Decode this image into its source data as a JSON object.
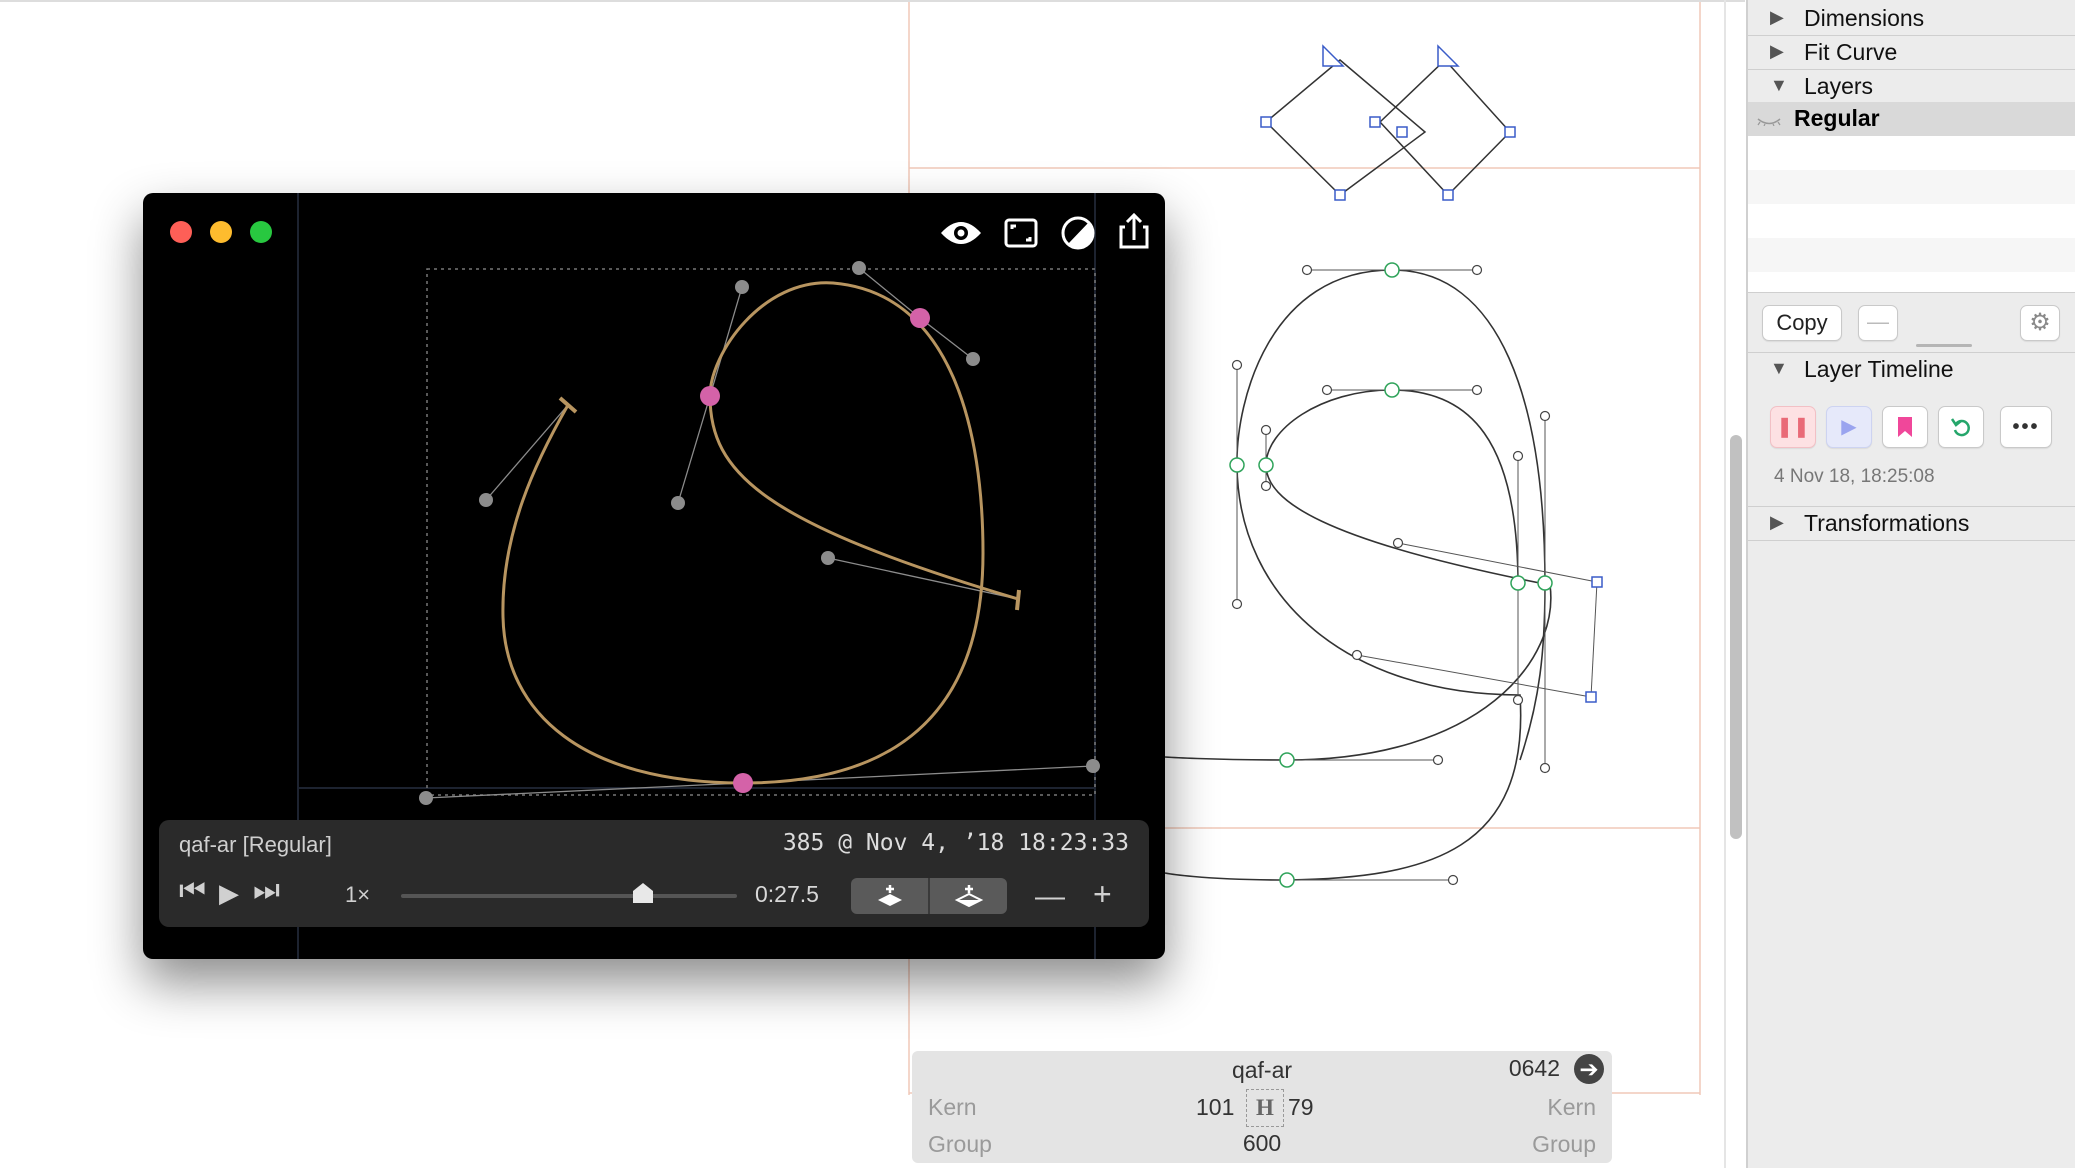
{
  "player": {
    "glyph_label": "qaf-ar [Regular]",
    "version_info": "385 @ Nov 4, ’18 18:23:33",
    "speed": "1×",
    "time": "0:27.5",
    "progress_fraction": 0.72,
    "icons": [
      "eye-icon",
      "fullscreen-icon",
      "contrast-icon",
      "share-icon",
      "skip-back-icon",
      "play-icon",
      "skip-forward-icon",
      "add-layer-icon",
      "add-layer-alt-icon",
      "zoom-out-icon",
      "zoom-in-icon"
    ],
    "symbols": {
      "skip_back": "⏮",
      "play": "▶",
      "skip_forward": "⏭",
      "minus": "—",
      "plus": "+"
    },
    "accent_stroke": "#b89560",
    "node_color": "#d462a8"
  },
  "sidebar": {
    "sections": {
      "dimensions": "Dimensions",
      "fit_curve": "Fit Curve",
      "layers": "Layers",
      "layer_timeline": "Layer Timeline",
      "transformations": "Transformations"
    },
    "collapsed_arrow": "▶",
    "expanded_arrow": "▼",
    "layers": [
      {
        "name": "Regular",
        "selected": true
      }
    ],
    "copy_label": "Copy",
    "minus_label": "—",
    "gear_symbol": "⚙",
    "timeline": {
      "pause_symbol": "❚❚",
      "play_symbol": "▶",
      "more_symbol": "•••",
      "date": "4 Nov 18, 18:25:08"
    }
  },
  "infobar": {
    "glyph_name": "qaf-ar",
    "unicode": "0642",
    "arrow_symbol": "➔",
    "kern_left_label": "Kern",
    "kern_right_label": "Kern",
    "group_left_label": "Group",
    "group_right_label": "Group",
    "left_sidebearing": "101",
    "right_sidebearing": "79",
    "advance_width": "600",
    "h_symbol": "H"
  },
  "colors": {
    "canvas_guides": "#f0c8b8",
    "node_green": "#2fa35a",
    "node_blue": "#3a5cc8"
  }
}
